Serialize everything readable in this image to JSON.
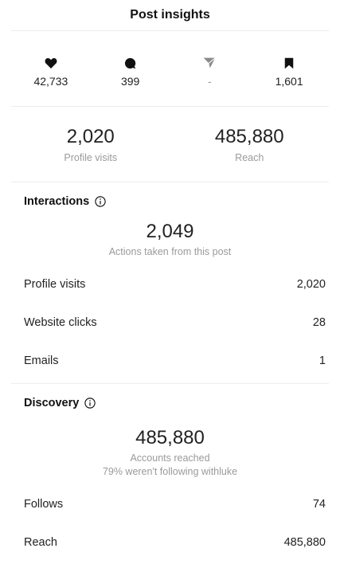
{
  "header": {
    "title": "Post insights"
  },
  "stats": {
    "likes": "42,733",
    "comments": "399",
    "shares": "-",
    "saves": "1,601"
  },
  "summary": {
    "profile_visits_value": "2,020",
    "profile_visits_label": "Profile visits",
    "reach_value": "485,880",
    "reach_label": "Reach"
  },
  "interactions": {
    "title": "Interactions",
    "total": "2,049",
    "subtitle": "Actions taken from this post",
    "rows": [
      {
        "label": "Profile visits",
        "value": "2,020"
      },
      {
        "label": "Website clicks",
        "value": "28"
      },
      {
        "label": "Emails",
        "value": "1"
      }
    ]
  },
  "discovery": {
    "title": "Discovery",
    "total": "485,880",
    "subtitle": "Accounts reached",
    "subtitle2": "79% weren't following withluke",
    "rows": [
      {
        "label": "Follows",
        "value": "74"
      },
      {
        "label": "Reach",
        "value": "485,880"
      }
    ]
  }
}
